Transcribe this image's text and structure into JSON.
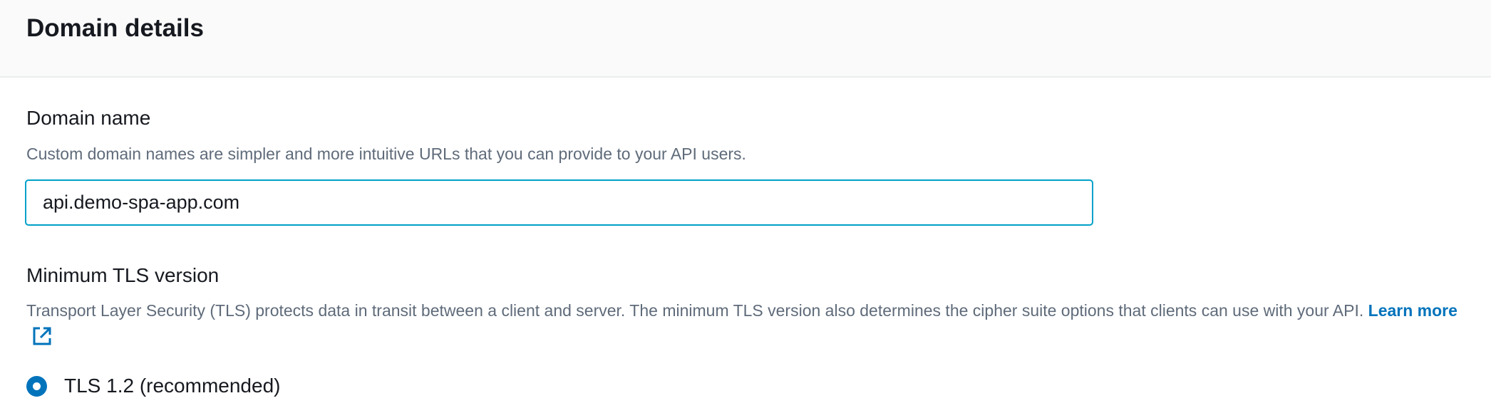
{
  "header": {
    "title": "Domain details"
  },
  "domain_name": {
    "label": "Domain name",
    "description": "Custom domain names are simpler and more intuitive URLs that you can provide to your API users.",
    "value": "api.demo-spa-app.com"
  },
  "tls": {
    "label": "Minimum TLS version",
    "description": "Transport Layer Security (TLS) protects data in transit between a client and server. The minimum TLS version also determines the cipher suite options that clients can use with your API.",
    "learn_more": "Learn more",
    "options": [
      {
        "label": "TLS 1.2 (recommended)",
        "selected": true
      }
    ]
  },
  "colors": {
    "accent": "#0073bb",
    "focus": "#00a1c9"
  }
}
